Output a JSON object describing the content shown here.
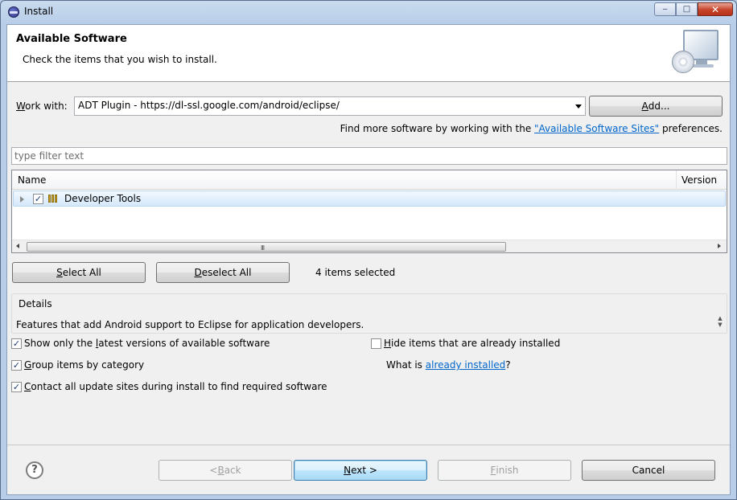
{
  "window": {
    "title": "Install",
    "minimize_glyph": "‒",
    "maximize_glyph": "□",
    "close_glyph": "✕"
  },
  "header": {
    "title": "Available Software",
    "subtitle": "Check the items that you wish to install.",
    "icon": "monitor-cd-icon"
  },
  "work_with": {
    "label_prefix": "W",
    "label_rest": "ork with:",
    "value": "ADT Plugin - https://dl-ssl.google.com/android/eclipse/",
    "add_button": {
      "mnemonic": "A",
      "rest": "dd..."
    }
  },
  "more_software": {
    "prefix": "Find more software by working with the ",
    "link": "\"Available Software Sites\"",
    "suffix": " preferences."
  },
  "filter": {
    "placeholder": "type filter text"
  },
  "tree": {
    "columns": [
      "Name",
      "Version"
    ],
    "rows": [
      {
        "label": "Developer Tools",
        "checked": true,
        "expanded": false
      }
    ],
    "scroll_grip": "III"
  },
  "selection": {
    "select_all": {
      "mnemonic": "S",
      "rest": "elect All"
    },
    "deselect_all": {
      "mnemonic": "D",
      "rest": "eselect All"
    },
    "count_text": "4 items selected"
  },
  "details": {
    "title": "Details",
    "text": "Features that add Android support to Eclipse for application developers."
  },
  "options": {
    "show_latest": {
      "checked": true,
      "before": "Show only the ",
      "mnemonic": "l",
      "after": "atest versions of available software"
    },
    "group_by_category": {
      "checked": true,
      "before": "",
      "mnemonic": "G",
      "after": "roup items by category"
    },
    "contact_sites": {
      "checked": true,
      "before": "",
      "mnemonic": "C",
      "after": "ontact all update sites during install to find required software"
    },
    "hide_installed": {
      "checked": false,
      "before": "",
      "mnemonic": "H",
      "after": "ide items that are already installed"
    },
    "what_is": {
      "prefix": "What is ",
      "link": "already installed",
      "suffix": "?"
    }
  },
  "footer": {
    "help_glyph": "?",
    "back": {
      "before": "< ",
      "mnemonic": "B",
      "after": "ack",
      "enabled": false
    },
    "next": {
      "before": "",
      "mnemonic": "N",
      "after": "ext >",
      "enabled": true
    },
    "finish": {
      "before": "",
      "mnemonic": "F",
      "after": "inish",
      "enabled": false
    },
    "cancel": {
      "label": "Cancel"
    }
  },
  "colors": {
    "link": "#0066cc",
    "selection_row": "#d5e8fb",
    "default_button_border": "#3c7fb1"
  }
}
